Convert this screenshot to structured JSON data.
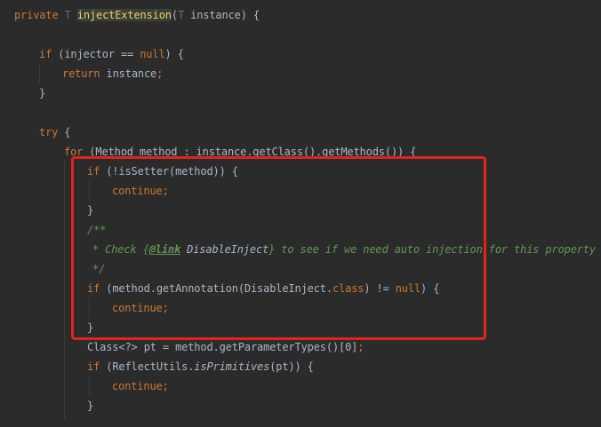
{
  "code": {
    "kw_private": "private",
    "type_param": "T",
    "method_name": "injectExtension",
    "param_name": "instance",
    "kw_if": "if",
    "injector_name": "injector",
    "op_eq": "==",
    "kw_null": "null",
    "kw_return": "return",
    "kw_try": "try",
    "kw_for": "for",
    "method_type": "Method",
    "method_var": "method",
    "get_class_call": "getClass()",
    "get_methods_call": "getMethods()",
    "is_setter_call": "isSetter",
    "kw_continue": "continue",
    "comment_open": "/**",
    "comment_star": "*",
    "comment_check": "Check",
    "comment_link_tag": "@link",
    "comment_link_target": "DisableInject",
    "comment_text_rest": "to see if we need auto injection for this property",
    "comment_close": "*/",
    "get_annotation_call": "getAnnotation",
    "disable_inject_class": "DisableInject",
    "kw_class": "class",
    "op_neq": "!=",
    "class_type": "Class",
    "wildcard_generic": "<?>",
    "pt_var": "pt",
    "get_param_types_call": "getParameterTypes()",
    "index_zero": "[0]",
    "reflect_utils": "ReflectUtils",
    "is_primitives_call": "isPrimitives"
  },
  "colors": {
    "background": "#2B2B2B",
    "keyword": "#CC7832",
    "method_declaration": "#FFC66D",
    "plain_text": "#A9B7C6",
    "doc_comment": "#629755",
    "static_call": "#9876AA",
    "type_param": "#507874",
    "highlight_box": "#E0241B"
  }
}
